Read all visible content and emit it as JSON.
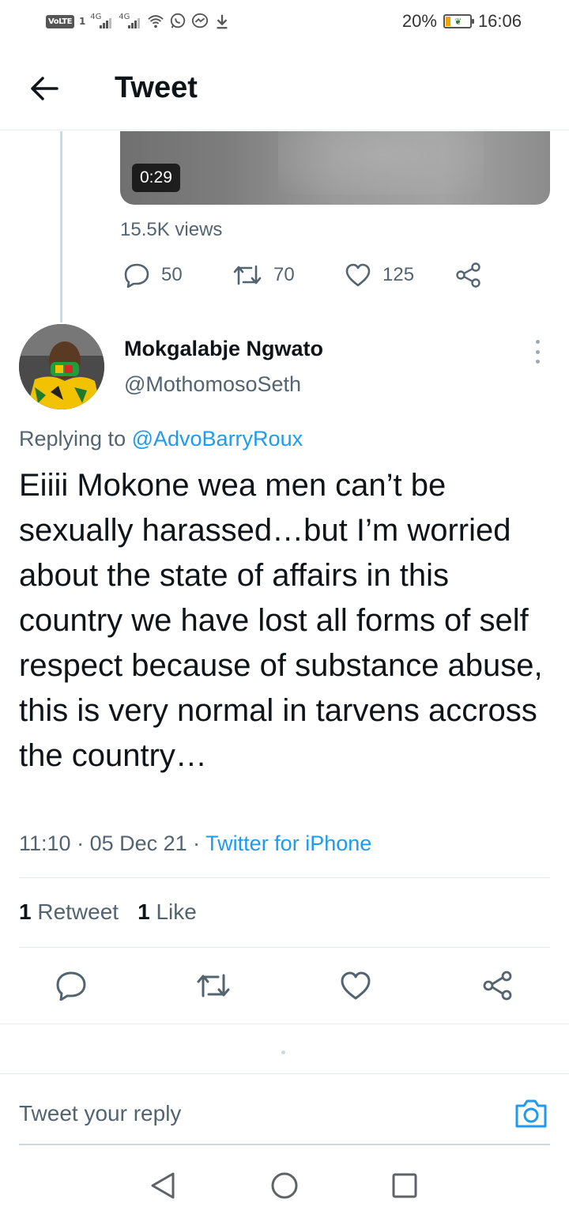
{
  "status_bar": {
    "volte": "VoLTE",
    "sim": "1",
    "signal1_label": "4G",
    "signal2_label": "4G",
    "battery_text": "20%",
    "battery_level": 0.2,
    "time": "16:06"
  },
  "header": {
    "title": "Tweet"
  },
  "parent_tweet": {
    "video_duration": "0:29",
    "views": "15.5K views",
    "replies": "50",
    "retweets": "70",
    "likes": "125"
  },
  "tweet": {
    "author_name": "Mokgalabje Ngwato",
    "author_handle": "@MothomosoSeth",
    "replying_prefix": "Replying to ",
    "replying_handle": "@AdvoBarryRoux",
    "text": "Eiiii Mokone wea men can’t be sexually harassed…but I’m worried about the state of affairs in this country we have lost all forms of self respect because of substance abuse, this is very normal in tarvens accross the country…",
    "time": "11:10",
    "date": "05 Dec 21",
    "separator": " · ",
    "source": "Twitter for iPhone",
    "retweet_count": "1",
    "retweet_label": "Retweet",
    "like_count": "1",
    "like_label": "Like"
  },
  "reply_bar": {
    "placeholder": "Tweet your reply"
  },
  "colors": {
    "accent": "#1d9bf0",
    "secondary_text": "#536471",
    "primary_text": "#0f1419"
  }
}
